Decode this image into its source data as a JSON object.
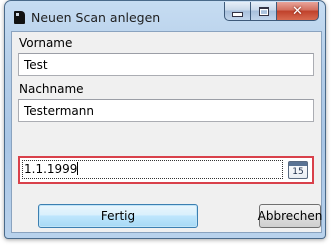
{
  "window": {
    "title": "Neuen Scan anlegen"
  },
  "icons": {
    "app": "app-icon",
    "minimize": "minimize-icon",
    "maximize": "maximize-icon",
    "close": "close-icon",
    "calendar": "calendar-icon"
  },
  "form": {
    "first_name_label": "Vorname",
    "first_name_value": "Test",
    "last_name_label": "Nachname",
    "last_name_value": "Testermann",
    "date_value": "1.1.1999",
    "calendar_day": "15"
  },
  "buttons": {
    "finish": "Fertig",
    "cancel": "Abbrechen"
  },
  "colors": {
    "validation_error_border": "#d9414b",
    "close_button": "#c0412b",
    "primary_button_border": "#3c7fb1"
  }
}
